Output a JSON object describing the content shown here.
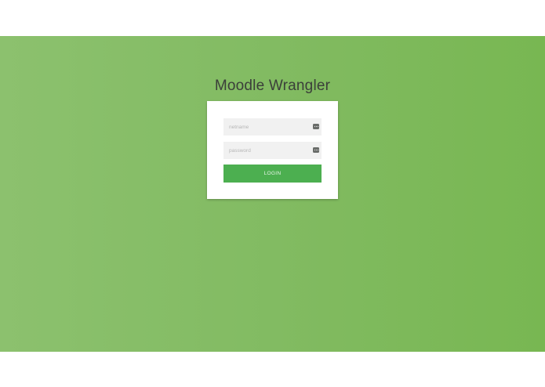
{
  "app": {
    "title": "Moodle Wrangler"
  },
  "login_form": {
    "username": {
      "placeholder": "netname",
      "value": "",
      "icon": "more-icon"
    },
    "password": {
      "placeholder": "password",
      "value": "",
      "icon": "more-icon"
    },
    "submit_label": "LOGIN"
  },
  "colors": {
    "hero_start": "#8cc16e",
    "hero_end": "#78b752",
    "button": "#4caf50",
    "card": "#ffffff",
    "field_bg": "#f1f1f1"
  }
}
